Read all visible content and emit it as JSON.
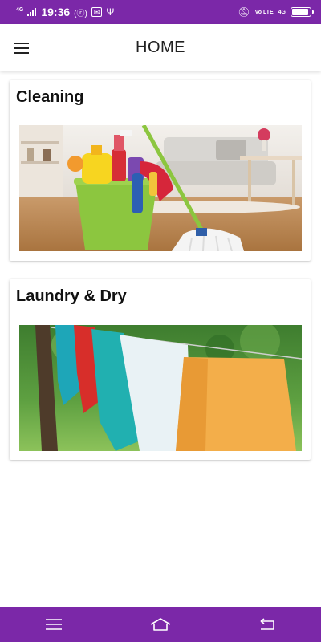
{
  "status_bar": {
    "network_label": "4G",
    "time": "19:36",
    "vowifi_label": "Vo LTE",
    "right_network_label": "4G",
    "battery_level": 0.9
  },
  "app_bar": {
    "title": "HOME"
  },
  "cards": [
    {
      "title": "Cleaning",
      "image": "cleaning-supplies-photo"
    },
    {
      "title": "Laundry & Dry",
      "image": "laundry-on-clothesline-photo"
    }
  ],
  "nav_bar": {
    "icons": [
      "menu-icon",
      "home-icon",
      "back-icon"
    ]
  },
  "colors": {
    "primary": "#7b28a8",
    "background": "#ffffff",
    "text": "#111111"
  }
}
